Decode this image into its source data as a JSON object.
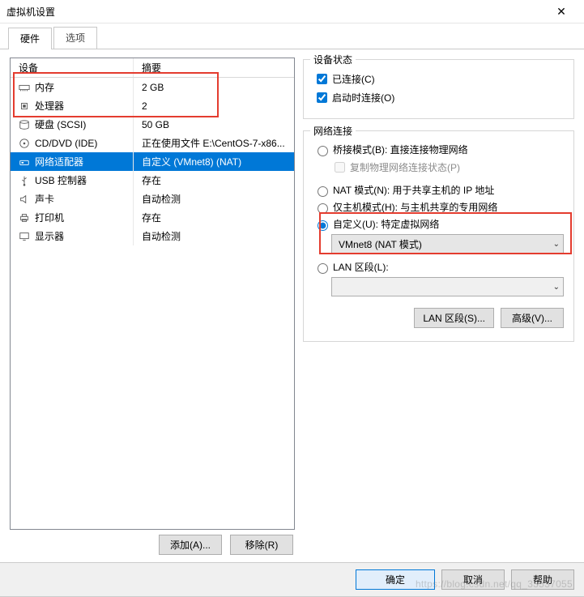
{
  "window": {
    "title": "虚拟机设置"
  },
  "tabs": {
    "hardware": "硬件",
    "options": "选项"
  },
  "table": {
    "head_device": "设备",
    "head_summary": "摘要",
    "rows": [
      {
        "icon": "memory",
        "device": "内存",
        "summary": "2 GB",
        "selected": false
      },
      {
        "icon": "cpu",
        "device": "处理器",
        "summary": "2",
        "selected": false
      },
      {
        "icon": "disk",
        "device": "硬盘 (SCSI)",
        "summary": "50 GB",
        "selected": false
      },
      {
        "icon": "cd",
        "device": "CD/DVD (IDE)",
        "summary": "正在使用文件 E:\\CentOS-7-x86...",
        "selected": false
      },
      {
        "icon": "net",
        "device": "网络适配器",
        "summary": "自定义 (VMnet8) (NAT)",
        "selected": true
      },
      {
        "icon": "usb",
        "device": "USB 控制器",
        "summary": "存在",
        "selected": false
      },
      {
        "icon": "sound",
        "device": "声卡",
        "summary": "自动检测",
        "selected": false
      },
      {
        "icon": "printer",
        "device": "打印机",
        "summary": "存在",
        "selected": false
      },
      {
        "icon": "display",
        "device": "显示器",
        "summary": "自动检测",
        "selected": false
      }
    ]
  },
  "left_buttons": {
    "add": "添加(A)...",
    "remove": "移除(R)"
  },
  "status": {
    "title": "设备状态",
    "connected": "已连接(C)",
    "connect_at_power_on": "启动时连接(O)"
  },
  "netconn": {
    "title": "网络连接",
    "bridged": "桥接模式(B): 直接连接物理网络",
    "replicate": "复制物理网络连接状态(P)",
    "nat": "NAT 模式(N): 用于共享主机的 IP 地址",
    "hostonly": "仅主机模式(H): 与主机共享的专用网络",
    "custom": "自定义(U): 特定虚拟网络",
    "custom_value": "VMnet8 (NAT 模式)",
    "lan_segment": "LAN 区段(L):",
    "lan_value": "",
    "btn_lan": "LAN 区段(S)...",
    "btn_advanced": "高级(V)..."
  },
  "footer": {
    "ok": "确定",
    "cancel": "取消",
    "help": "帮助"
  },
  "watermark": "https://blog.csdn.net/qq_33537055"
}
